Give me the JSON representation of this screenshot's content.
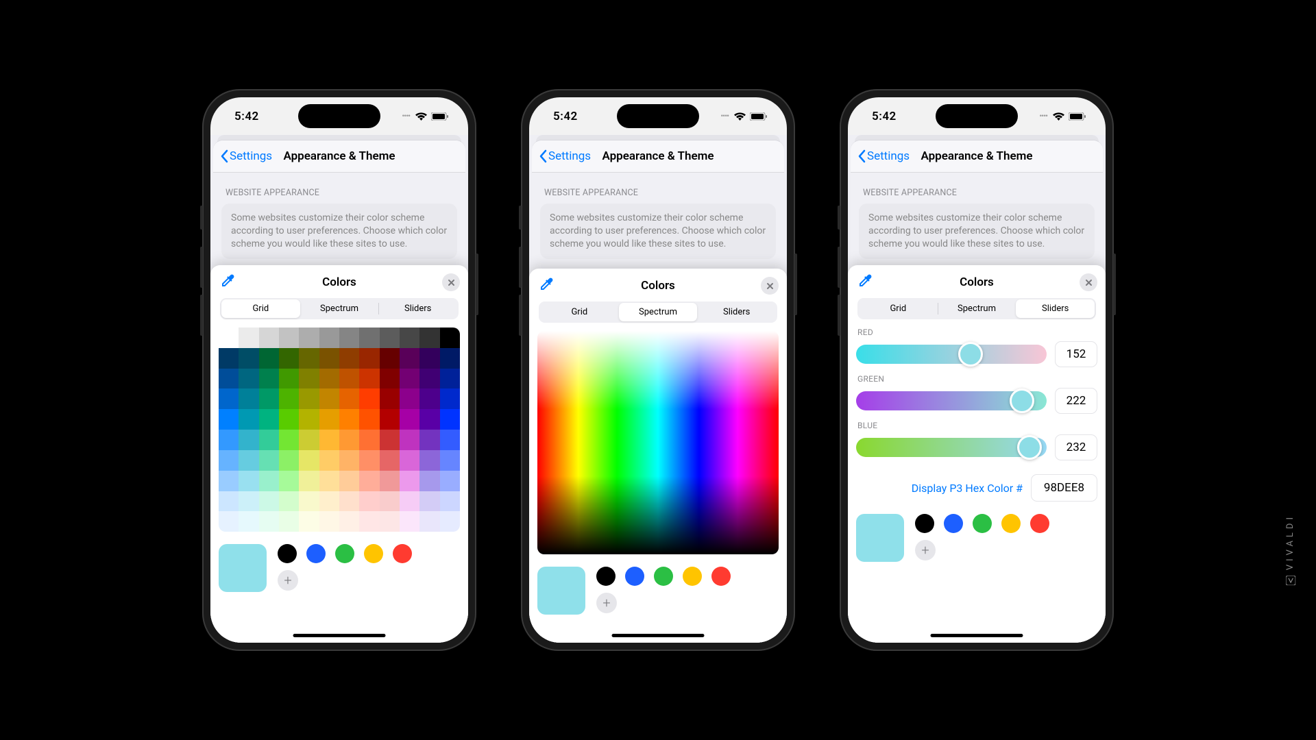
{
  "statusbar": {
    "time": "5:42"
  },
  "settings": {
    "back_label": "Settings",
    "page_title": "Appearance & Theme",
    "section_label": "WEBSITE APPEARANCE",
    "description": "Some websites customize their color scheme according to user preferences. Choose which color scheme you would like these sites to use."
  },
  "color_sheet": {
    "title": "Colors",
    "tabs": {
      "grid": "Grid",
      "spectrum": "Spectrum",
      "sliders": "Sliders"
    },
    "current_color": "#8fe0ea",
    "preset_colors": [
      "#000000",
      "#1d5fff",
      "#2bbf44",
      "#ffc400",
      "#ff3b30"
    ]
  },
  "sliders": {
    "red": {
      "label": "RED",
      "value": 152,
      "perc": 60
    },
    "green": {
      "label": "GREEN",
      "value": 222,
      "perc": 87
    },
    "blue": {
      "label": "BLUE",
      "value": 232,
      "perc": 91
    },
    "hex_label": "Display P3 Hex Color #",
    "hex_value": "98DEE8"
  },
  "watermark": "VIVALDI",
  "grid_colors": [
    [
      "#ffffff",
      "#ebebeb",
      "#d6d6d6",
      "#c2c2c2",
      "#adadad",
      "#999999",
      "#858585",
      "#707070",
      "#5c5c5c",
      "#474747",
      "#333333",
      "#000000"
    ],
    [
      "#003a66",
      "#004d66",
      "#006633",
      "#336600",
      "#666600",
      "#7a5200",
      "#8f3d00",
      "#992600",
      "#660000",
      "#590059",
      "#33005c",
      "#001a66"
    ],
    [
      "#004d99",
      "#006680",
      "#00804d",
      "#409900",
      "#808000",
      "#a36b00",
      "#bf5200",
      "#cc3300",
      "#800000",
      "#730073",
      "#400073",
      "#002199"
    ],
    [
      "#0066cc",
      "#008099",
      "#009966",
      "#4db300",
      "#999900",
      "#c28500",
      "#e66300",
      "#ff3d00",
      "#990000",
      "#8c008c",
      "#4d008c",
      "#0029cc"
    ],
    [
      "#0080ff",
      "#0099b3",
      "#00b380",
      "#59cc00",
      "#b3b300",
      "#e69e00",
      "#ff8000",
      "#ff5200",
      "#b30000",
      "#a600a6",
      "#5900a6",
      "#0033ff"
    ],
    [
      "#3399ff",
      "#33b3cc",
      "#33cc99",
      "#73e633",
      "#cccc33",
      "#ffb833",
      "#ff9933",
      "#ff7033",
      "#cc3333",
      "#bf33bf",
      "#7333bf",
      "#335cff"
    ],
    [
      "#66b3ff",
      "#66cce0",
      "#66e0b3",
      "#8cf066",
      "#e6e666",
      "#ffcc66",
      "#ffb366",
      "#ff8f66",
      "#e66666",
      "#d966d9",
      "#8c66d9",
      "#6685ff"
    ],
    [
      "#99ccff",
      "#99e0f0",
      "#99f0cc",
      "#a6fa99",
      "#f0f099",
      "#ffdf99",
      "#ffcc99",
      "#ffad99",
      "#f09999",
      "#ec99ec",
      "#a699ec",
      "#99adff"
    ],
    [
      "#cce6ff",
      "#ccf0f9",
      "#ccf9e6",
      "#d3fdcc",
      "#f9f9cc",
      "#ffefcc",
      "#ffe0cc",
      "#ffcecc",
      "#f9cccc",
      "#f6ccf6",
      "#d3ccf6",
      "#ccd6ff"
    ],
    [
      "#e6f2ff",
      "#e6f9fd",
      "#e6fdf2",
      "#e9fee6",
      "#fdfde6",
      "#fff7e6",
      "#fff0e6",
      "#ffe6e6",
      "#fde6e6",
      "#fbe6fb",
      "#e9e6fb",
      "#e6ebff"
    ]
  ]
}
